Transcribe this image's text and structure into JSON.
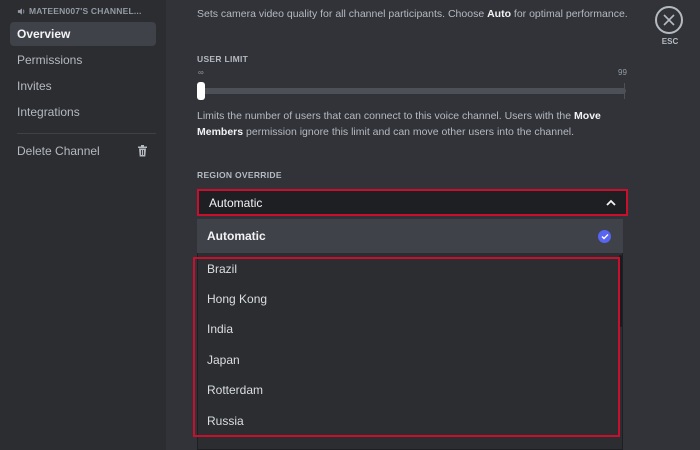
{
  "sidebar": {
    "channel_name": "MATEEN007'S CHANNEL...",
    "items": [
      {
        "label": "Overview"
      },
      {
        "label": "Permissions"
      },
      {
        "label": "Invites"
      },
      {
        "label": "Integrations"
      }
    ],
    "delete_label": "Delete Channel"
  },
  "main": {
    "quality_desc_pre": "Sets camera video quality for all channel participants. Choose ",
    "quality_desc_bold": "Auto",
    "quality_desc_post": " for optimal performance.",
    "user_limit": {
      "label": "USER LIMIT",
      "min_marker": "∞",
      "max_marker": "99",
      "value_fraction": 0,
      "desc_pre": "Limits the number of users that can connect to this voice channel. Users with the ",
      "desc_bold": "Move Members",
      "desc_post": " permission ignore this limit and can move other users into the channel."
    },
    "region": {
      "label": "REGION OVERRIDE",
      "selected": "Automatic",
      "options_selected": "Automatic",
      "options": [
        "Brazil",
        "Hong Kong",
        "India",
        "Japan",
        "Rotterdam",
        "Russia"
      ]
    }
  },
  "close": {
    "label": "ESC"
  },
  "colors": {
    "accent": "#5865f2",
    "highlight_border": "#c8102e",
    "background": "#313338",
    "sidebar": "#2b2d31"
  },
  "icons": [
    "speaker-icon",
    "trash-icon",
    "close-icon",
    "chevron-up-icon",
    "check-icon"
  ]
}
